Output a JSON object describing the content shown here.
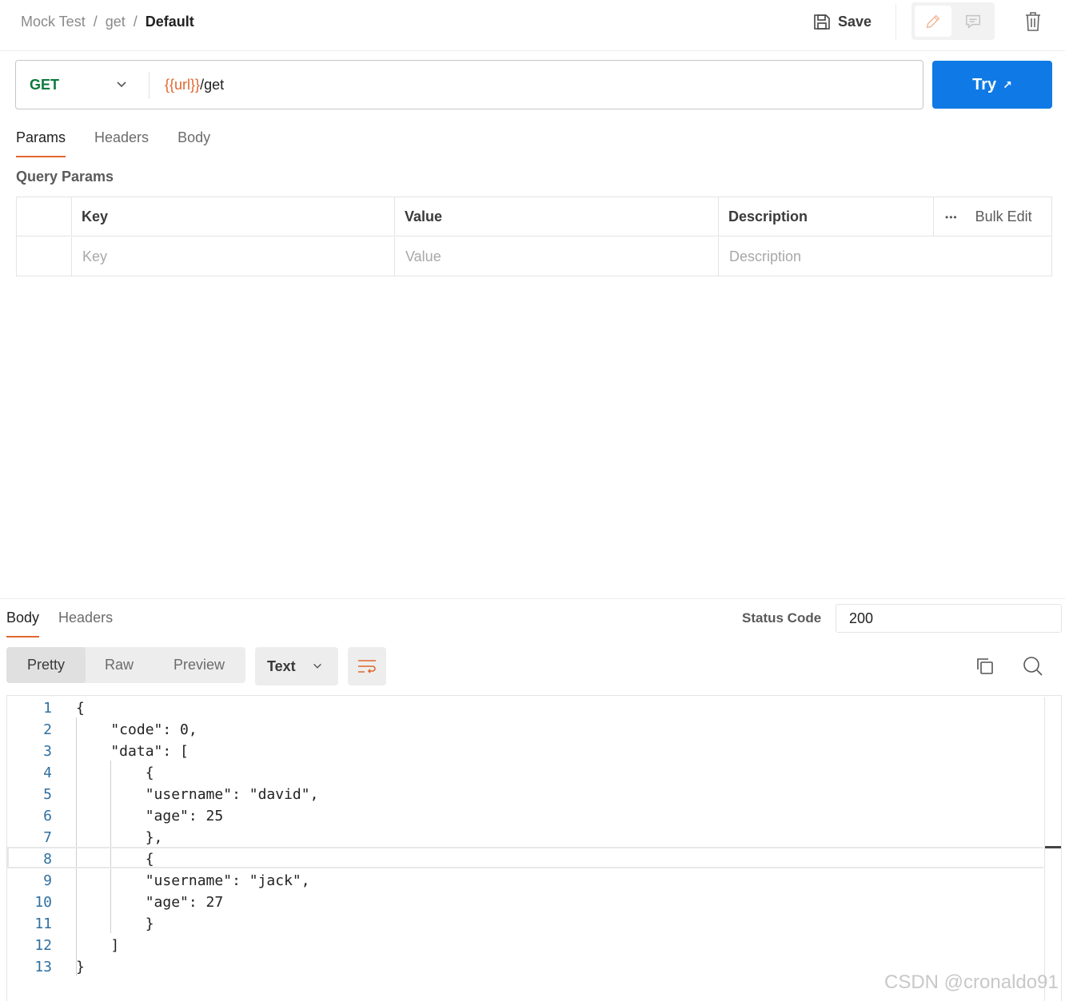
{
  "breadcrumb": {
    "project": "Mock Test",
    "folder": "get",
    "current": "Default",
    "separator": "/"
  },
  "toolbar": {
    "save_label": "Save"
  },
  "request": {
    "method": "GET",
    "url_variable": "{{url}}",
    "url_path": "/get",
    "try_label": "Try",
    "try_icon": "↗"
  },
  "tabs": {
    "params": "Params",
    "headers": "Headers",
    "body": "Body"
  },
  "params": {
    "section_title": "Query Params",
    "columns": {
      "key": "Key",
      "value": "Value",
      "description": "Description"
    },
    "bulk_edit": "Bulk Edit",
    "more_icon": "•••",
    "placeholders": {
      "key": "Key",
      "value": "Value",
      "description": "Description"
    }
  },
  "response": {
    "tabs": {
      "body": "Body",
      "headers": "Headers"
    },
    "status_label": "Status Code",
    "status_value": "200",
    "formats": {
      "pretty": "Pretty",
      "raw": "Raw",
      "preview": "Preview"
    },
    "language": "Text",
    "lines": [
      {
        "n": "1",
        "t": "{"
      },
      {
        "n": "2",
        "t": "    \"code\": 0,"
      },
      {
        "n": "3",
        "t": "    \"data\": ["
      },
      {
        "n": "4",
        "t": "        {"
      },
      {
        "n": "5",
        "t": "        \"username\": \"david\","
      },
      {
        "n": "6",
        "t": "        \"age\": 25"
      },
      {
        "n": "7",
        "t": "        },"
      },
      {
        "n": "8",
        "t": "        {"
      },
      {
        "n": "9",
        "t": "        \"username\": \"jack\","
      },
      {
        "n": "10",
        "t": "        \"age\": 27"
      },
      {
        "n": "11",
        "t": "        }"
      },
      {
        "n": "12",
        "t": "    ]"
      },
      {
        "n": "13",
        "t": "}"
      }
    ]
  },
  "watermark": "CSDN @cronaldo91",
  "colors": {
    "accent": "#e0672d",
    "primary": "#0f7ae5",
    "method": "#0b7a3d"
  }
}
